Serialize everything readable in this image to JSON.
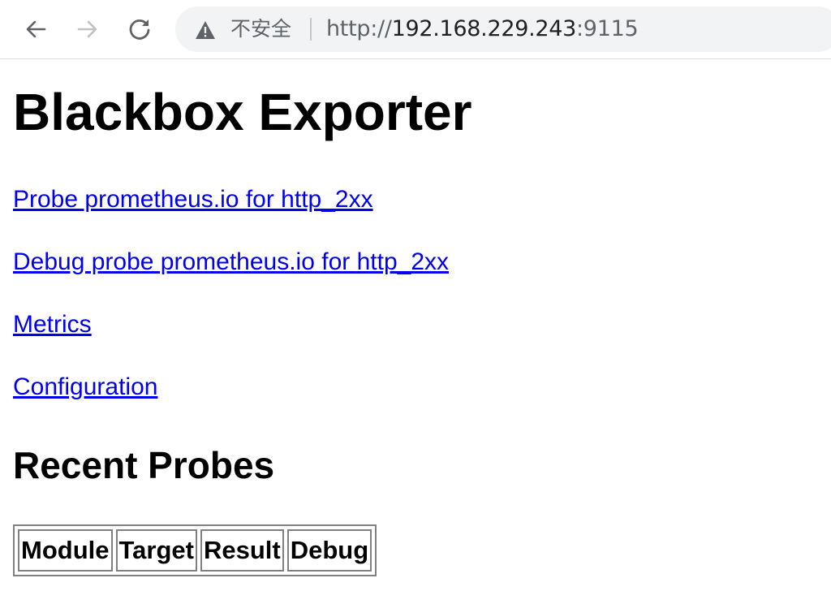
{
  "browser": {
    "security_label": "不安全",
    "url_scheme": "http://",
    "url_host": "192.168.229.243",
    "url_port": ":9115",
    "icons": {
      "back": "arrow-left-icon",
      "forward": "arrow-right-icon",
      "reload": "reload-icon",
      "security": "warning-triangle-icon"
    }
  },
  "page": {
    "title": "Blackbox Exporter",
    "links": [
      "Probe prometheus.io for http_2xx",
      "Debug probe prometheus.io for http_2xx",
      "Metrics",
      "Configuration"
    ],
    "recent_heading": "Recent Probes",
    "table_headers": [
      "Module",
      "Target",
      "Result",
      "Debug"
    ],
    "link_color": "#0000ee"
  }
}
